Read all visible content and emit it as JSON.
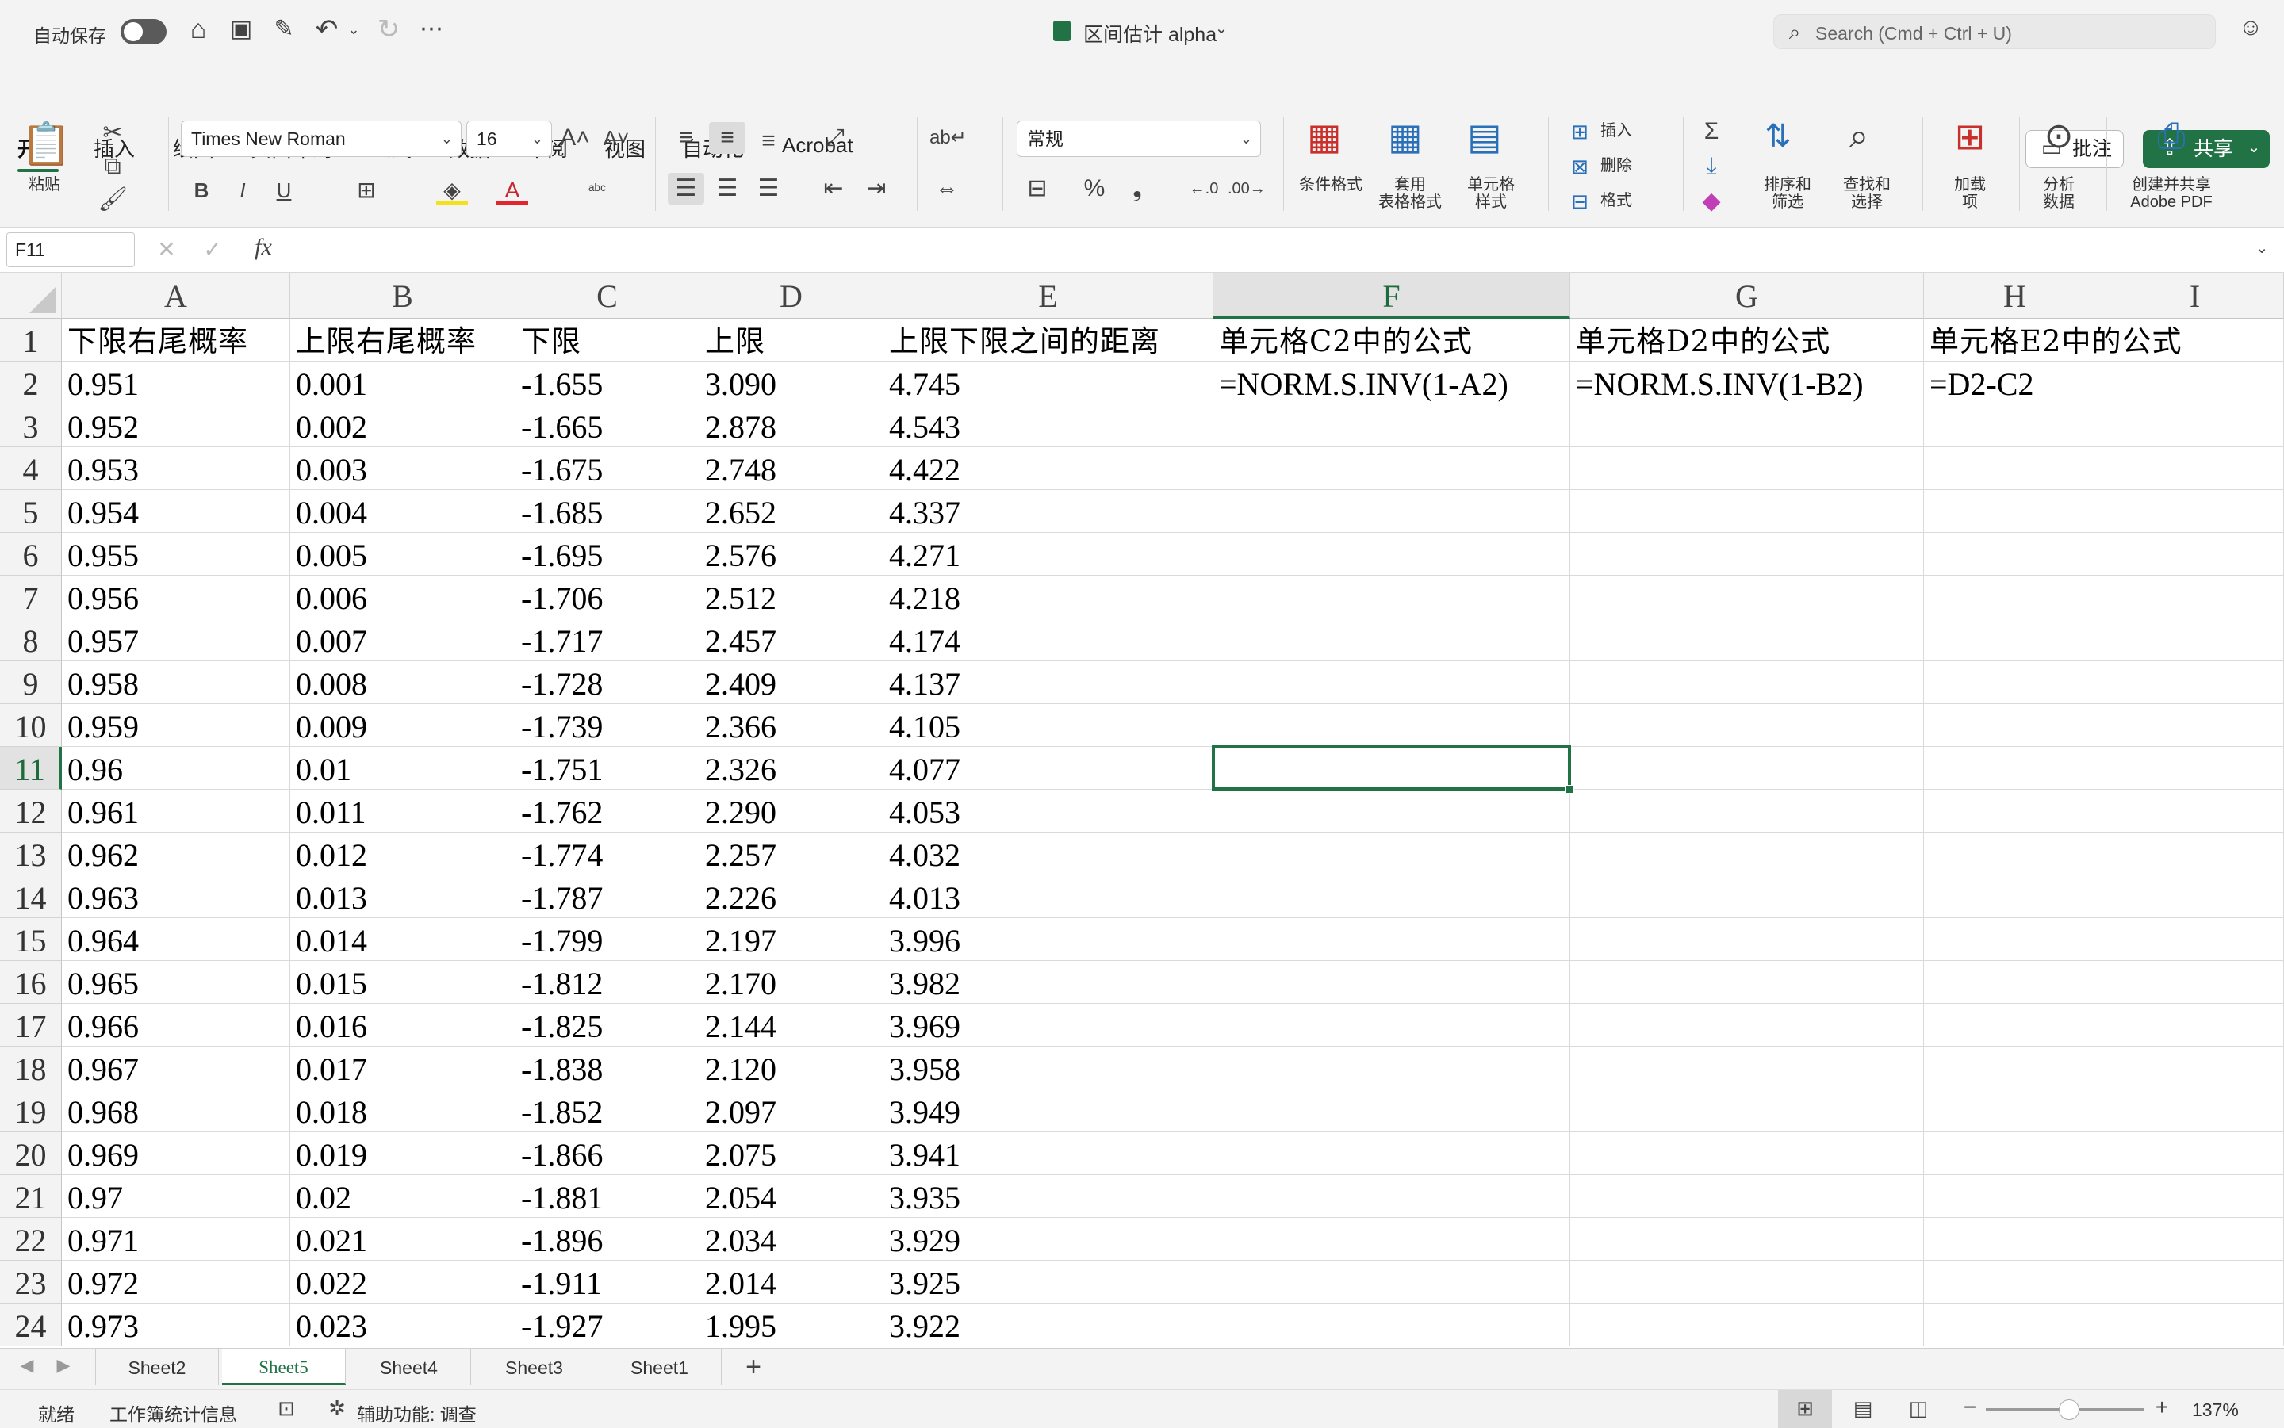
{
  "titlebar": {
    "autosave_label": "自动保存",
    "doc_title": "区间估计 alpha",
    "search_placeholder": "Search (Cmd + Ctrl + U)"
  },
  "ribbon_tabs": [
    "开始",
    "插入",
    "绘图",
    "页面布局",
    "公式",
    "数据",
    "审阅",
    "视图",
    "自动化",
    "Acrobat"
  ],
  "actions": {
    "comment": "批注",
    "share": "共享"
  },
  "ribbon": {
    "paste": "粘贴",
    "font_name": "Times New Roman",
    "font_size": "16",
    "number_format": "常规",
    "cond_format": "条件格式",
    "table_format_1": "套用",
    "table_format_2": "表格格式",
    "cell_style_1": "单元格",
    "cell_style_2": "样式",
    "insert": "插入",
    "delete": "删除",
    "format": "格式",
    "sort_1": "排序和",
    "sort_2": "筛选",
    "find_1": "查找和",
    "find_2": "选择",
    "addins_1": "加载",
    "addins_2": "项",
    "analyze_1": "分析",
    "analyze_2": "数据",
    "pdf_1": "创建并共享",
    "pdf_2": "Adobe PDF"
  },
  "formula_bar": {
    "name_box": "F11",
    "fx": "fx",
    "content": ""
  },
  "columns": [
    "A",
    "B",
    "C",
    "D",
    "E",
    "F",
    "G",
    "H",
    "I"
  ],
  "selected_cell": "F11",
  "header_row": [
    "下限右尾概率",
    "上限右尾概率",
    "下限",
    "上限",
    "上限下限之间的距离",
    "单元格C2中的公式",
    "单元格D2中的公式",
    "单元格E2中的公式",
    ""
  ],
  "formula_row": [
    "=NORM.S.INV(1-A2)",
    "=NORM.S.INV(1-B2)",
    "=D2-C2"
  ],
  "rows": [
    [
      "0.951",
      "0.001",
      "-1.655",
      "3.090",
      "4.745"
    ],
    [
      "0.952",
      "0.002",
      "-1.665",
      "2.878",
      "4.543"
    ],
    [
      "0.953",
      "0.003",
      "-1.675",
      "2.748",
      "4.422"
    ],
    [
      "0.954",
      "0.004",
      "-1.685",
      "2.652",
      "4.337"
    ],
    [
      "0.955",
      "0.005",
      "-1.695",
      "2.576",
      "4.271"
    ],
    [
      "0.956",
      "0.006",
      "-1.706",
      "2.512",
      "4.218"
    ],
    [
      "0.957",
      "0.007",
      "-1.717",
      "2.457",
      "4.174"
    ],
    [
      "0.958",
      "0.008",
      "-1.728",
      "2.409",
      "4.137"
    ],
    [
      "0.959",
      "0.009",
      "-1.739",
      "2.366",
      "4.105"
    ],
    [
      "0.96",
      "0.01",
      "-1.751",
      "2.326",
      "4.077"
    ],
    [
      "0.961",
      "0.011",
      "-1.762",
      "2.290",
      "4.053"
    ],
    [
      "0.962",
      "0.012",
      "-1.774",
      "2.257",
      "4.032"
    ],
    [
      "0.963",
      "0.013",
      "-1.787",
      "2.226",
      "4.013"
    ],
    [
      "0.964",
      "0.014",
      "-1.799",
      "2.197",
      "3.996"
    ],
    [
      "0.965",
      "0.015",
      "-1.812",
      "2.170",
      "3.982"
    ],
    [
      "0.966",
      "0.016",
      "-1.825",
      "2.144",
      "3.969"
    ],
    [
      "0.967",
      "0.017",
      "-1.838",
      "2.120",
      "3.958"
    ],
    [
      "0.968",
      "0.018",
      "-1.852",
      "2.097",
      "3.949"
    ],
    [
      "0.969",
      "0.019",
      "-1.866",
      "2.075",
      "3.941"
    ],
    [
      "0.97",
      "0.02",
      "-1.881",
      "2.054",
      "3.935"
    ],
    [
      "0.971",
      "0.021",
      "-1.896",
      "2.034",
      "3.929"
    ],
    [
      "0.972",
      "0.022",
      "-1.911",
      "2.014",
      "3.925"
    ],
    [
      "0.973",
      "0.023",
      "-1.927",
      "1.995",
      "3.922"
    ]
  ],
  "sheet_tabs": [
    "Sheet2",
    "Sheet5",
    "Sheet4",
    "Sheet3",
    "Sheet1"
  ],
  "active_sheet": "Sheet5",
  "status": {
    "ready": "就绪",
    "workbook_stats": "工作簿统计信息",
    "accessibility": "辅助功能: 调查",
    "zoom": "137%"
  }
}
